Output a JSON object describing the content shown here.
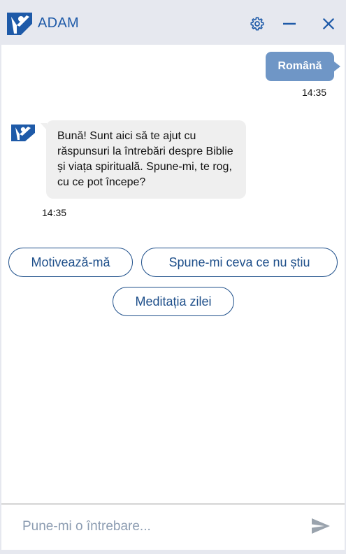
{
  "app": {
    "title": "ADAM",
    "brand_color": "#1e5aa8"
  },
  "header": {
    "icons": [
      "logo-icon",
      "gear-icon",
      "minimize-icon",
      "close-icon"
    ]
  },
  "messages": [
    {
      "from": "user",
      "text": "Română",
      "time": "14:35"
    },
    {
      "from": "bot",
      "text": "Bună! Sunt aici să te ajut cu răspunsuri la întrebări despre Biblie și viața spirituală. Spune-mi, te rog, cu ce pot începe?",
      "time": "14:35"
    }
  ],
  "suggestions": [
    "Motivează-mă",
    "Spune-mi ceva ce nu știu",
    "Meditația zilei"
  ],
  "input": {
    "placeholder": "Pune-mi o întrebare...",
    "value": ""
  },
  "colors": {
    "user_bubble": "#6f96c6",
    "bot_bubble": "#efefef",
    "chip_border": "#1e4f8a",
    "header_bg": "#e6e8ef"
  }
}
